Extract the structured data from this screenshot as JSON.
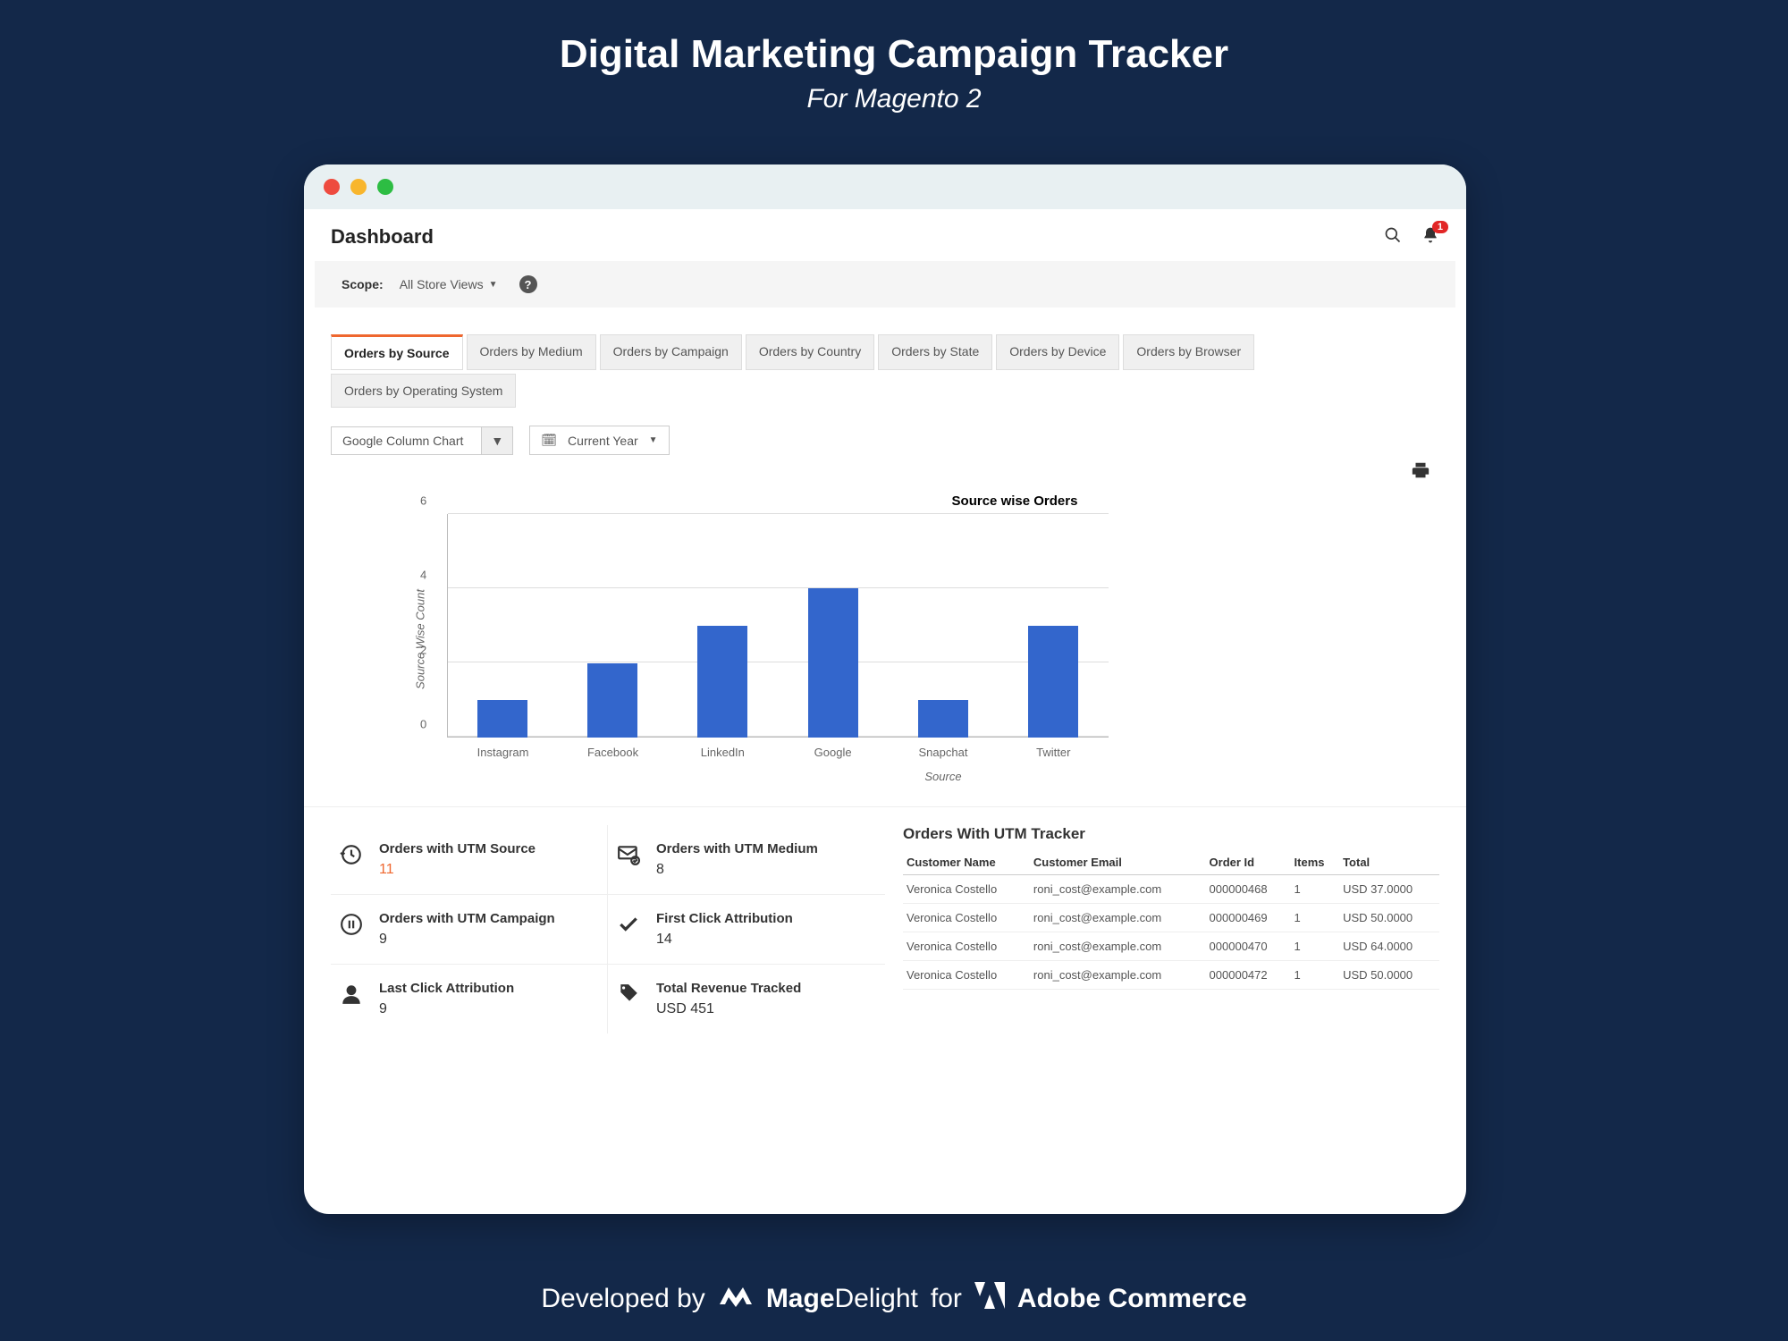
{
  "promo": {
    "title": "Digital Marketing Campaign Tracker",
    "subtitle": "For Magento 2"
  },
  "header": {
    "title": "Dashboard",
    "notif_count": "1"
  },
  "scope": {
    "label": "Scope:",
    "value": "All Store Views"
  },
  "tabs": [
    "Orders by Source",
    "Orders by Medium",
    "Orders by Campaign",
    "Orders by Country",
    "Orders by State",
    "Orders by Device",
    "Orders by Browser",
    "Orders by Operating System"
  ],
  "controls": {
    "chart_type": "Google Column Chart",
    "period": "Current Year"
  },
  "chart_data": {
    "type": "bar",
    "title": "Source wise Orders",
    "ylabel": "Source Wise Count",
    "xlabel": "Source",
    "ylim": [
      0,
      6
    ],
    "yticks": [
      0,
      2,
      4,
      6
    ],
    "categories": [
      "Instagram",
      "Facebook",
      "LinkedIn",
      "Google",
      "Snapchat",
      "Twitter"
    ],
    "values": [
      1,
      2,
      3,
      4,
      1,
      3
    ]
  },
  "metrics": [
    {
      "icon": "history",
      "label": "Orders with UTM Source",
      "value": "11",
      "orange": true
    },
    {
      "icon": "mail-check",
      "label": "Orders with UTM Medium",
      "value": "8"
    },
    {
      "icon": "pause",
      "label": "Orders with UTM Campaign",
      "value": "9"
    },
    {
      "icon": "check",
      "label": "First Click Attribution",
      "value": "14"
    },
    {
      "icon": "user",
      "label": "Last Click Attribution",
      "value": "9"
    },
    {
      "icon": "tag",
      "label": "Total Revenue Tracked",
      "value": "USD 451"
    }
  ],
  "table": {
    "title": "Orders With UTM Tracker",
    "headers": [
      "Customer Name",
      "Customer Email",
      "Order Id",
      "Items",
      "Total"
    ],
    "rows": [
      [
        "Veronica Costello",
        "roni_cost@example.com",
        "000000468",
        "1",
        "USD 37.0000"
      ],
      [
        "Veronica Costello",
        "roni_cost@example.com",
        "000000469",
        "1",
        "USD 50.0000"
      ],
      [
        "Veronica Costello",
        "roni_cost@example.com",
        "000000470",
        "1",
        "USD 64.0000"
      ],
      [
        "Veronica Costello",
        "roni_cost@example.com",
        "000000472",
        "1",
        "USD 50.0000"
      ]
    ]
  },
  "footer": {
    "dev_by": "Developed by",
    "brand1a": "Mage",
    "brand1b": "Delight",
    "for": "for",
    "brand2": "Adobe Commerce"
  }
}
